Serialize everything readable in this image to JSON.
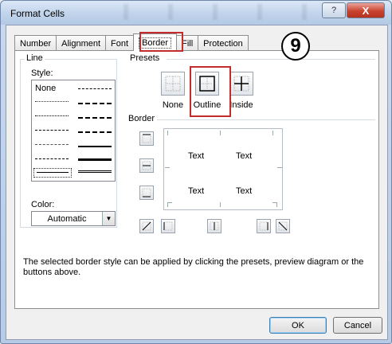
{
  "window": {
    "title": "Format Cells",
    "help_label": "?",
    "close_label": "X"
  },
  "tabs": [
    "Number",
    "Alignment",
    "Font",
    "Border",
    "Fill",
    "Protection"
  ],
  "active_tab": "Border",
  "step_badge": "9",
  "line": {
    "group_label": "Line",
    "style_label": "Style:",
    "style_none": "None",
    "color_label": "Color:",
    "color_value": "Automatic"
  },
  "presets": {
    "group_label": "Presets",
    "items": [
      "None",
      "Outline",
      "Inside"
    ],
    "highlighted": "Outline"
  },
  "border": {
    "group_label": "Border",
    "preview_texts": [
      "Text",
      "Text",
      "Text",
      "Text"
    ]
  },
  "description": "The selected border style can be applied by clicking the presets, preview diagram or the buttons above.",
  "buttons": {
    "ok": "OK",
    "cancel": "Cancel"
  },
  "colors": {
    "highlight_red": "#c52b2b",
    "close_red": "#c9442f"
  }
}
